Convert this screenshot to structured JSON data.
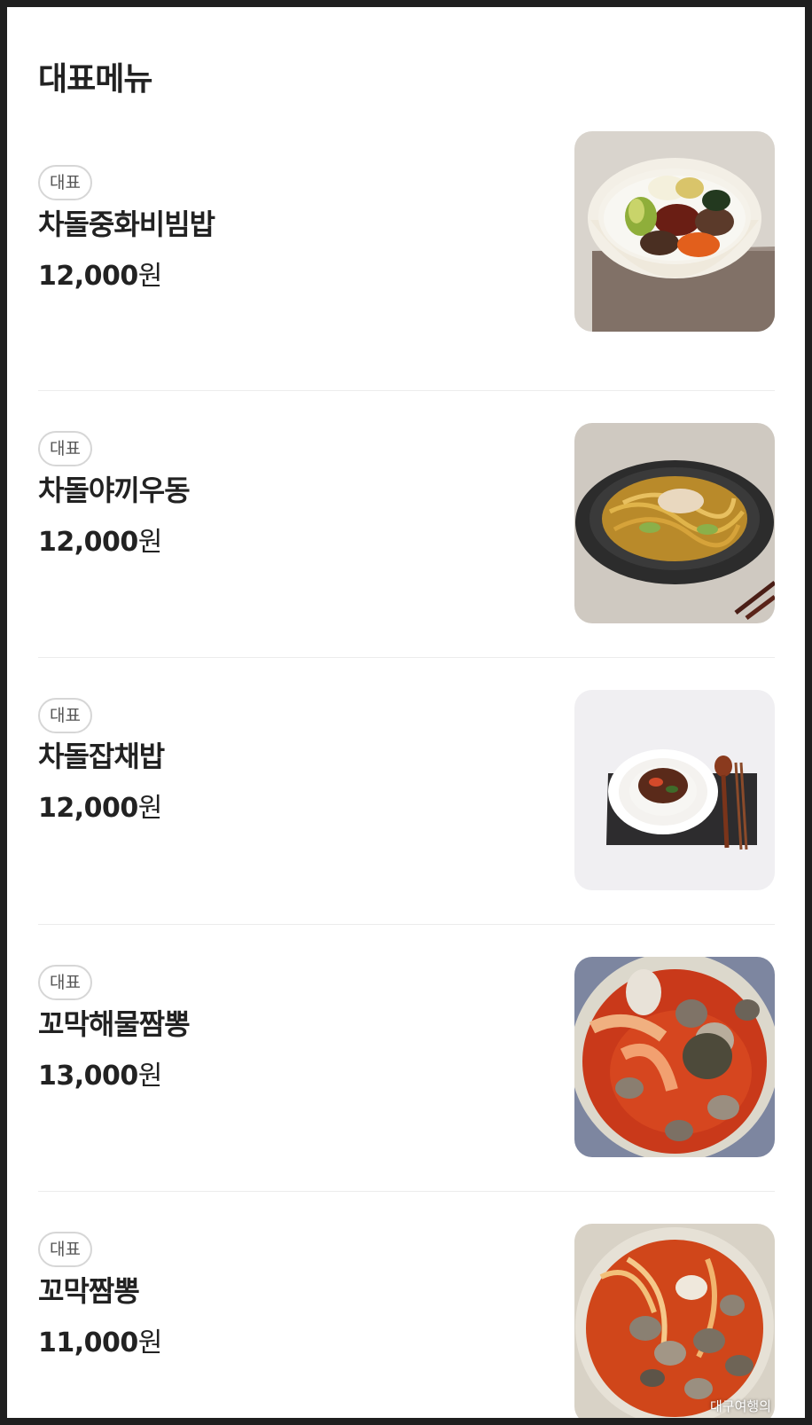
{
  "section": {
    "title": "대표메뉴"
  },
  "menu": [
    {
      "badge": "대표",
      "name": "차돌중화비빔밥",
      "price": "12,000",
      "currency": "원",
      "image": "bibimbap-photo"
    },
    {
      "badge": "대표",
      "name": "차돌야끼우동",
      "price": "12,000",
      "currency": "원",
      "image": "yaki-udon-photo"
    },
    {
      "badge": "대표",
      "name": "차돌잡채밥",
      "price": "12,000",
      "currency": "원",
      "image": "japchae-rice-photo"
    },
    {
      "badge": "대표",
      "name": "꼬막해물짬뽕",
      "price": "13,000",
      "currency": "원",
      "image": "seafood-jjamppong-photo"
    },
    {
      "badge": "대표",
      "name": "꼬막짬뽕",
      "price": "11,000",
      "currency": "원",
      "image": "cockle-jjamppong-photo",
      "watermark": "대구여행의"
    }
  ]
}
